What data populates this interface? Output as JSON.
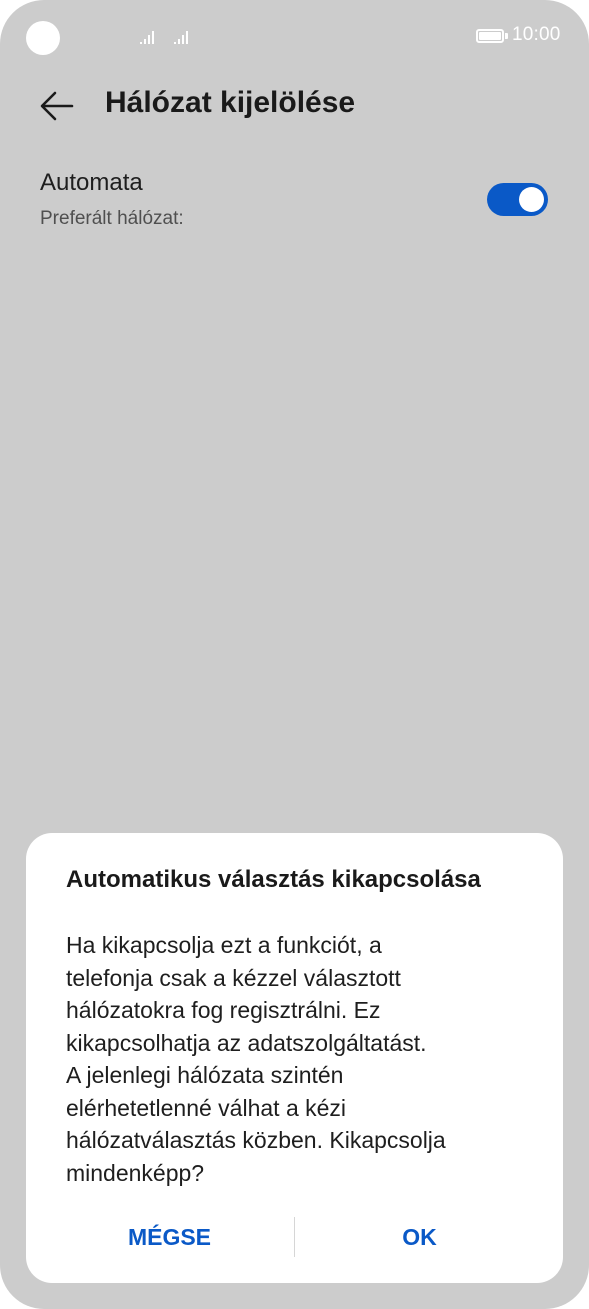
{
  "status_bar": {
    "time": "10:00",
    "icons": [
      "camera-cutout",
      "signal-icon",
      "signal-icon",
      "battery-icon"
    ]
  },
  "header": {
    "back_icon": "arrow-left-icon",
    "title": "Hálózat kijelölése"
  },
  "setting": {
    "title": "Automata",
    "subtitle": "Preferált hálózat:",
    "toggle_on": true,
    "accent_color": "#0a59c7"
  },
  "dialog": {
    "title": "Automatikus választás kikapcsolása",
    "message_lines": [
      "Ha kikapcsolja ezt a funkciót, a",
      "telefonja csak a kézzel választott",
      "hálózatokra fog regisztrálni. Ez",
      "kikapcsolhatja az adatszolgáltatást.",
      "A jelenlegi hálózata szintén",
      "elérhetetlenné válhat a kézi",
      "hálózatválasztás közben. Kikapcsolja",
      "mindenképp?"
    ],
    "cancel_label": "MÉGSE",
    "ok_label": "OK"
  },
  "colors": {
    "background_dimmed": "#cccccc",
    "dialog_background": "#ffffff",
    "accent": "#0a59c7"
  }
}
